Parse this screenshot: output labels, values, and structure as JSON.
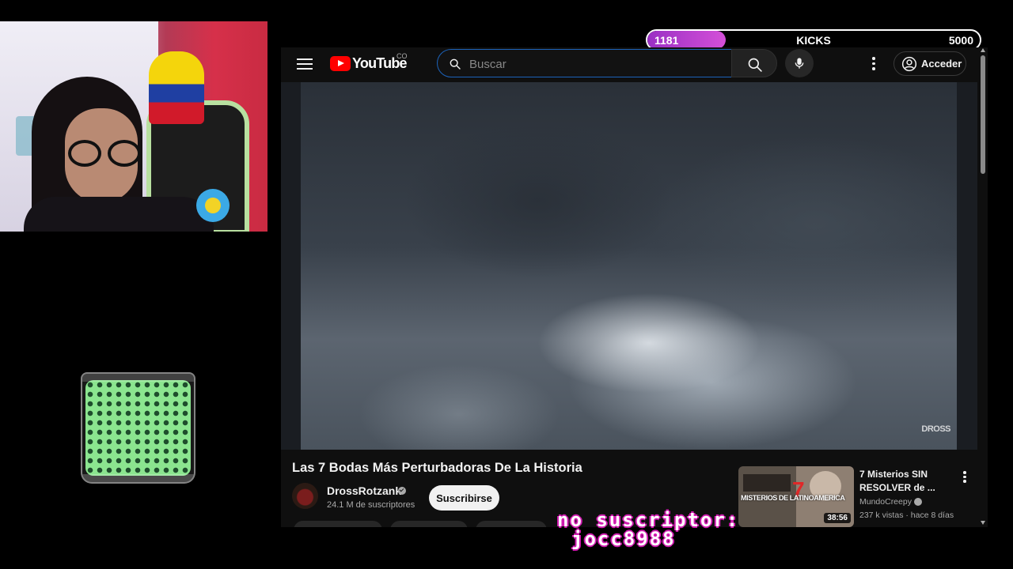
{
  "kicks_bar": {
    "current": "1181",
    "label": "KICKS",
    "goal": "5000",
    "progress_fraction": 0.2362
  },
  "youtube": {
    "logo_text": "YouTube",
    "country_code": "CO",
    "search": {
      "placeholder": "Buscar",
      "value": ""
    },
    "signin_label": "Acceder",
    "player": {
      "watermark": "DROSS"
    },
    "video": {
      "title": "Las 7 Bodas Más Perturbadoras De La Historia",
      "channel": "DrossRotzank",
      "subscribers": "24.1 M de suscriptores",
      "subscribe_label": "Suscribirse"
    },
    "recommendation": {
      "title": "7 Misterios SIN RESOLVER de ...",
      "thumbnail_caption": "MISTERIOS DE LATINOAMERICA",
      "thumbnail_number": "7",
      "duration": "38:56",
      "channel": "MundoCreepy",
      "meta": "237 k vistas · hace 8 días"
    }
  },
  "overlay": {
    "line1": "no suscriptor:",
    "line2": "jocc8988"
  },
  "icons": [
    "menu-icon",
    "youtube-logo-icon",
    "search-icon",
    "mic-icon",
    "more-vert-icon",
    "account-icon",
    "verified-icon"
  ],
  "colors": {
    "accent_red": "#ff0000",
    "kicks_purple": "#c446d4",
    "overlay_pink": "#d01bb0",
    "search_border": "#1c62b9"
  }
}
